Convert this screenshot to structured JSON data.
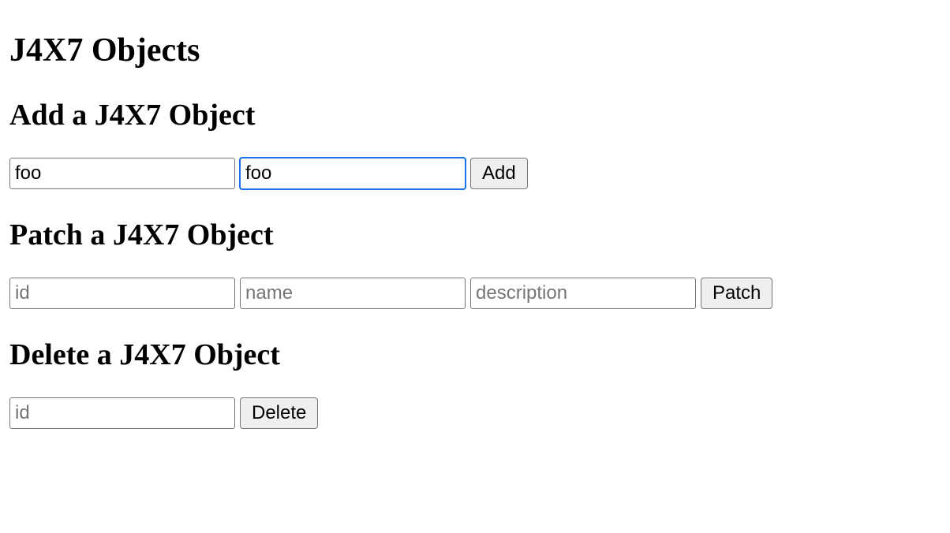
{
  "page_title": "J4X7 Objects",
  "add": {
    "heading": "Add a J4X7 Object",
    "name_value": "foo",
    "description_value": "foo",
    "name_placeholder": "",
    "description_placeholder": "",
    "button_label": "Add"
  },
  "patch": {
    "heading": "Patch a J4X7 Object",
    "id_value": "",
    "name_value": "",
    "description_value": "",
    "id_placeholder": "id",
    "name_placeholder": "name",
    "description_placeholder": "description",
    "button_label": "Patch"
  },
  "delete": {
    "heading": "Delete a J4X7 Object",
    "id_value": "",
    "id_placeholder": "id",
    "button_label": "Delete"
  }
}
